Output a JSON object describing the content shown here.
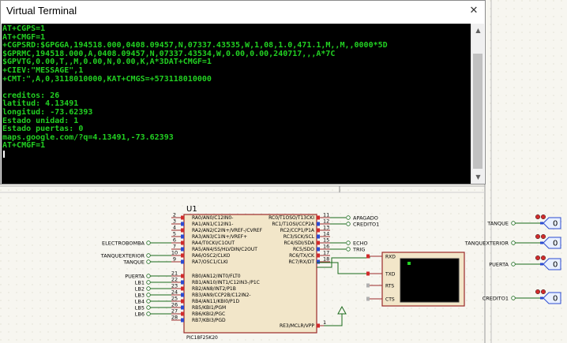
{
  "terminal": {
    "title": "Virtual Terminal",
    "close_glyph": "✕",
    "lines": [
      "AT+CGPS=1",
      "AT+CMGF=1",
      "+CGPSRD:$GPGGA,194518.000,0408.09457,N,07337.43535,W,1,08,1.0,471.1,M,,M,,0000*5D",
      "$GPRMC,194518.000,A,0408.09457,N,07337.43534,W,0.00,0.00,240717,,,A*7C",
      "$GPVTG,0.00,T,,M,0.00,N,0.00,K,A*3DAT+CMGF=1",
      "+CIEV:\"MESSAGE\",1",
      "+CMT:\",A,0,3118010000,KAT+CMGS=+573118010000",
      "",
      "creditos: 26",
      "latitud: 4.13491",
      "longitud: -73.62393",
      "Estado unidad: 1",
      "Estado puertas: 0",
      "maps.google.com/?q=4.13491,-73.62393",
      "AT+CMGF=1",
      ""
    ],
    "text_color": "#22d022",
    "background": "#000000"
  },
  "schematic": {
    "chip": {
      "ref": "U1",
      "part": "PIC18F25K20",
      "left_pins": [
        {
          "num": "2",
          "name": "RA0/AN0/C12IN0-"
        },
        {
          "num": "3",
          "name": "RA1/AN1/C12IN1-"
        },
        {
          "num": "4",
          "name": "RA2/AN2/C2IN+/VREF-/CVREF"
        },
        {
          "num": "5",
          "name": "RA3/AN3/C1IN+/VREF+"
        },
        {
          "num": "6",
          "name": "RA4/T0CKI/C1OUT"
        },
        {
          "num": "7",
          "name": "RA5/AN4/SS/HLVDIN/C2OUT"
        },
        {
          "num": "10",
          "name": "RA6/OSC2/CLKO"
        },
        {
          "num": "9",
          "name": "RA7/OSC1/CLKI"
        },
        {
          "num": "21",
          "name": "RB0/AN12/INT0/FLT0"
        },
        {
          "num": "22",
          "name": "RB1/AN10/INT1/C12IN3-/P1C"
        },
        {
          "num": "23",
          "name": "RB2/AN8/INT2/P1B"
        },
        {
          "num": "24",
          "name": "RB3/AN9/CCP2B/C12IN2-"
        },
        {
          "num": "25",
          "name": "RB4/AN11/KBI0/P1D"
        },
        {
          "num": "26",
          "name": "RB5/KBI1/PGM"
        },
        {
          "num": "27",
          "name": "RB6/KBI2/PGC"
        },
        {
          "num": "28",
          "name": "RB7/KBI3/PGD"
        }
      ],
      "right_pins": [
        {
          "num": "11",
          "name": "RC0/T1OSO/T13CKI"
        },
        {
          "num": "12",
          "name": "RC1/T1OSI/CCP2A"
        },
        {
          "num": "13",
          "name": "RC2/CCP1/P1A"
        },
        {
          "num": "14",
          "name": "RC3/SCK/SCL"
        },
        {
          "num": "15",
          "name": "RC4/SDI/SDA"
        },
        {
          "num": "16",
          "name": "RC5/SDO"
        },
        {
          "num": "17",
          "name": "RC6/TX/CK"
        },
        {
          "num": "18",
          "name": "RC7/RX/DT"
        }
      ],
      "mclr_pin": {
        "num": "1",
        "name": "RE3/MCLR/VPP"
      }
    },
    "left_nets": [
      "ELECTROBOMBA",
      "TANQUEXTERIOR",
      "TANQUE",
      "PUERTA",
      "LB1",
      "LB2",
      "LB3",
      "LB4",
      "LB5",
      "LB6"
    ],
    "right_nets": [
      "APAGADO",
      "CREDITO1",
      "ECHO",
      "TRIG"
    ],
    "far_right_nets": [
      "TANQUE",
      "TANQUEXTERIOR",
      "PUERTA",
      "CREDITO1"
    ],
    "probe_value": "0",
    "terminal_pins": [
      "RXD",
      "TXD",
      "RTS",
      "CTS"
    ]
  }
}
